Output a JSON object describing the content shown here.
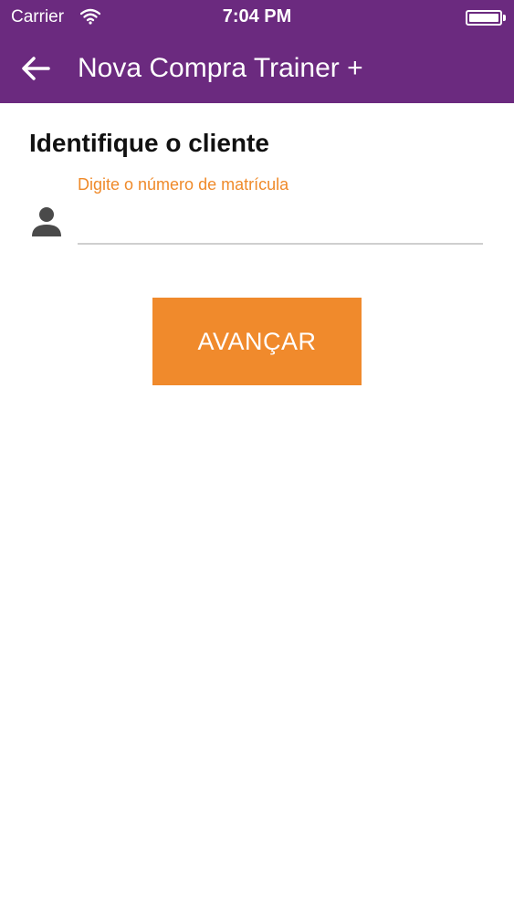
{
  "status_bar": {
    "carrier": "Carrier",
    "time": "7:04 PM"
  },
  "header": {
    "title": "Nova Compra Trainer +",
    "color": "#6b2a7f"
  },
  "form": {
    "heading": "Identifique o cliente",
    "field_label": "Digite o número de matrícula",
    "field_value": "",
    "accent_color": "#ef8a2a"
  },
  "actions": {
    "advance_label": "AVANÇAR",
    "button_color": "#f08a2c"
  }
}
